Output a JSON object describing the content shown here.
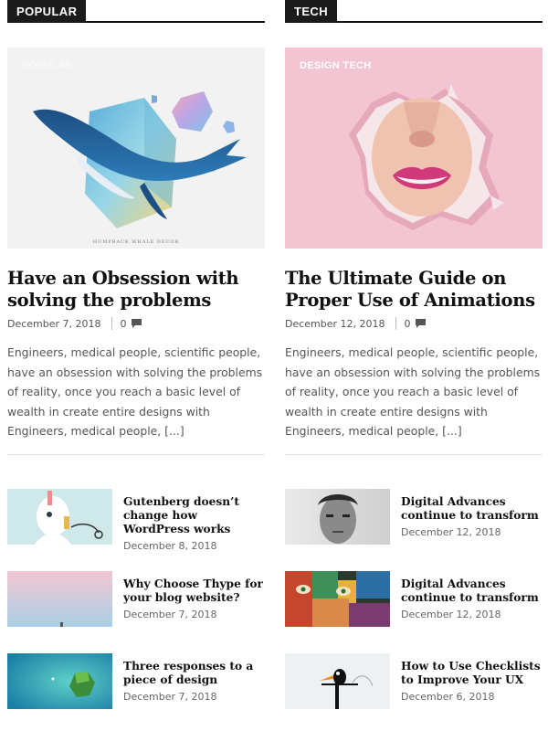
{
  "columns": [
    {
      "section_label": "POPULAR",
      "feature": {
        "image_category": "POPULAR",
        "image_caption": "HUMPBACK WHALE DECOR",
        "title": "Have an Obsession with solving the problems",
        "date": "December 7, 2018",
        "comments": "0",
        "excerpt": "Engineers, medical people, scientific people, have an obsession with solving the problems of reality, once you reach a basic level of wealth in create entire designs with Engineers, medical people, [...]"
      },
      "posts": [
        {
          "title": "Gutenberg doesn’t change how WordPress works",
          "date": "December 8, 2018",
          "thumb_icon": "illustration-thumb"
        },
        {
          "title": "Why Choose Thype for your blog website?",
          "date": "December 7, 2018",
          "thumb_icon": "pastel-sky-thumb"
        },
        {
          "title": "Three responses to a piece of design",
          "date": "December 7, 2018",
          "thumb_icon": "island-thumb"
        }
      ]
    },
    {
      "section_label": "TECH",
      "feature": {
        "image_category": "DESIGN TECH",
        "title": "The Ultimate Guide on Proper Use of Animations",
        "date": "December 12, 2018",
        "comments": "0",
        "excerpt": "Engineers, medical people, scientific people, have an obsession with solving the problems of reality, once you reach a basic level of wealth in create entire designs with Engineers, medical people, [...]"
      },
      "posts": [
        {
          "title": "Digital Advances continue to transform",
          "date": "December 12, 2018",
          "thumb_icon": "portrait-thumb"
        },
        {
          "title": "Digital Advances continue to transform",
          "date": "December 12, 2018",
          "thumb_icon": "graffiti-thumb"
        },
        {
          "title": "How to Use Checklists to Improve Your UX",
          "date": "December 6, 2018",
          "thumb_icon": "toucan-thumb"
        }
      ]
    }
  ],
  "colors": {
    "section_label_bg": "#1b1b1b",
    "left_feature_bg": "#f2f2f2",
    "right_feature_bg": "#f3c4d2",
    "meta_text": "#555555"
  }
}
